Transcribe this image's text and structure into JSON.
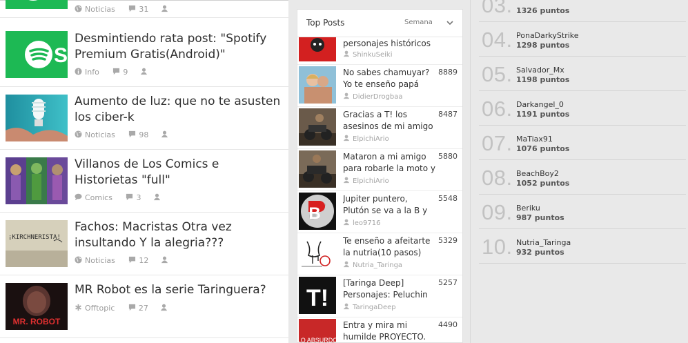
{
  "feed": {
    "posts": [
      {
        "title": "",
        "category": "Noticias",
        "comments": "31",
        "cat_icon": "globe-icon"
      },
      {
        "title": "Desmintiendo rata post: \"Spotify Premium Gratis(Android)\"",
        "category": "Info",
        "comments": "9",
        "cat_icon": "info-icon"
      },
      {
        "title": "Aumento de luz: que no te asusten los ciber-k",
        "category": "Noticias",
        "comments": "98",
        "cat_icon": "globe-icon"
      },
      {
        "title": "Villanos de Los Comics e Historietas \"full\"",
        "category": "Comics",
        "comments": "3",
        "cat_icon": "speech-icon"
      },
      {
        "title": "Fachos: Macristas Otra vez insultando Y la alegria???",
        "category": "Noticias",
        "comments": "12",
        "cat_icon": "globe-icon"
      },
      {
        "title": "MR Robot es la serie Taringuera?",
        "category": "Offtopic",
        "comments": "27",
        "cat_icon": "asterisk-icon"
      }
    ],
    "thumb_texts": {
      "spotify": "Sp",
      "kirchnerista": "¡KIRCHNERISTA!",
      "mrrobot": "MR. ROBOT"
    }
  },
  "top_posts": {
    "title": "Top Posts",
    "period": "Semana",
    "items": [
      {
        "title": "personajes históricos",
        "score": "",
        "author": "ShinkuSeiki"
      },
      {
        "title": "No sabes chamuyar? Yo te enseño papá",
        "score": "8889",
        "author": "DidierDrogbaa"
      },
      {
        "title": "Gracias a T! los asesinos de mi amigo",
        "score": "8487",
        "author": "ElpichiArio"
      },
      {
        "title": "Mataron a mi amigo para robarle la moto y",
        "score": "5880",
        "author": "ElpichiArio"
      },
      {
        "title": "Jupiter puntero, Plutón se va a la B y Nibiru a la",
        "score": "5548",
        "author": "leo9716"
      },
      {
        "title": "Te enseño a afeitarte la nutria(10 pasos)",
        "score": "5329",
        "author": "Nutria_Taringa"
      },
      {
        "title": "[Taringa Deep] Personajes: Peluchin",
        "score": "5257",
        "author": "TaringaDeep"
      },
      {
        "title": "Entra y mira mi humilde PROYECTO.",
        "score": "4490",
        "author": ""
      }
    ],
    "thumb_texts": {
      "b_letter": "B",
      "tlogo": "T!",
      "absurdo": "LO ABSURDO"
    }
  },
  "ranking": {
    "items": [
      {
        "num": "03.",
        "user": "",
        "points": "1326 puntos"
      },
      {
        "num": "04.",
        "user": "PonaDarkyStrike",
        "points": "1298 puntos"
      },
      {
        "num": "05.",
        "user": "Salvador_Mx",
        "points": "1198 puntos"
      },
      {
        "num": "06.",
        "user": "Darkangel_0",
        "points": "1191 puntos"
      },
      {
        "num": "07.",
        "user": "MaTiax91",
        "points": "1076 puntos"
      },
      {
        "num": "08.",
        "user": "BeachBoy2",
        "points": "1052 puntos"
      },
      {
        "num": "09.",
        "user": "Beriku",
        "points": "987 puntos"
      },
      {
        "num": "10.",
        "user": "Nutria_Taringa",
        "points": "932 puntos"
      }
    ]
  },
  "colors": {
    "spotify_green": "#1db954",
    "meta_gray": "#9a9a9a",
    "rank_number": "#c2c2c2"
  }
}
